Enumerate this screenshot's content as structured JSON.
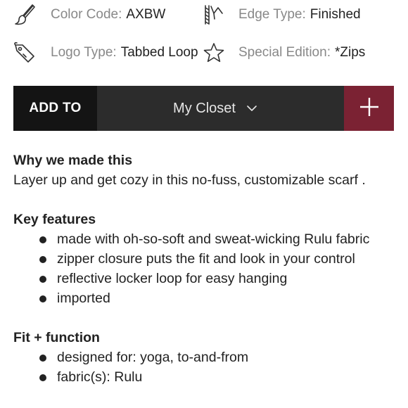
{
  "attributes": {
    "color_code": {
      "label": "Color Code:",
      "value": "AXBW",
      "icon": "paintbrush-icon"
    },
    "edge_type": {
      "label": "Edge Type:",
      "value": "Finished",
      "icon": "sewing-edge-icon"
    },
    "logo_type": {
      "label": "Logo Type:",
      "value": "Tabbed Loop",
      "icon": "tag-icon"
    },
    "special_edition": {
      "label": "Special Edition:",
      "value": "*Zips",
      "icon": "star-icon"
    }
  },
  "add_bar": {
    "add_label": "ADD TO",
    "selected_list": "My Closet",
    "plus_icon": "plus-icon",
    "chevron_icon": "chevron-down-icon",
    "colors": {
      "label_bg": "#141414",
      "bar_bg": "#2c2c2c",
      "plus_bg": "#7b2233"
    }
  },
  "why": {
    "heading": "Why we made this",
    "body": "Layer up and get cozy in this no-fuss, customizable scarf ."
  },
  "key_features": {
    "heading": "Key features",
    "items": [
      "made with oh-so-soft and sweat-wicking Rulu fabric",
      "zipper closure puts the fit and look in your control",
      "reflective locker loop for easy hanging",
      "imported"
    ]
  },
  "fit_function": {
    "heading": "Fit + function",
    "items": [
      "designed for: yoga, to-and-from",
      "fabric(s): Rulu"
    ]
  }
}
